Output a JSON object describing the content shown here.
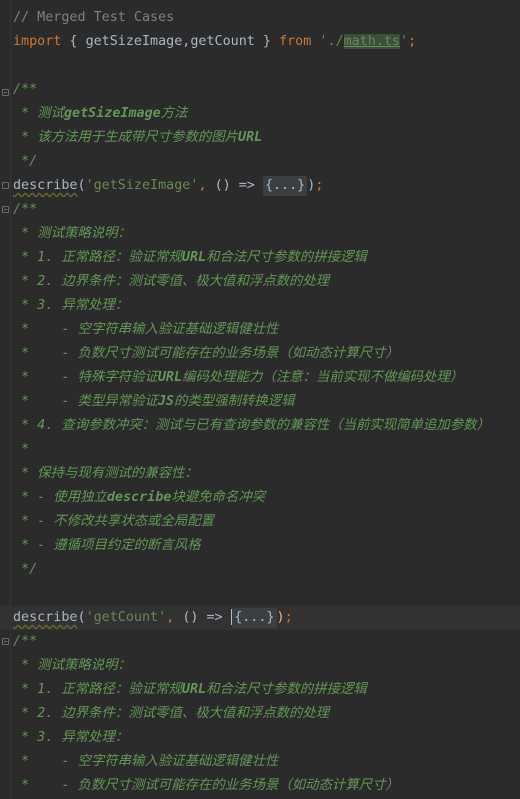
{
  "editor": {
    "lines": [
      {
        "t": "comment",
        "text": "// Merged Test Cases"
      },
      {
        "t": "import",
        "kw1": "import",
        "open": " { ",
        "names": "getSizeImage,getCount",
        "close": " } ",
        "kw2": "from",
        "sp": " ",
        "q1": "'./",
        "path": "math.ts",
        "q2": "'",
        "semi": ";"
      },
      {
        "t": "blank"
      },
      {
        "t": "doc",
        "text": "/**"
      },
      {
        "t": "doc",
        "text": " * 测试",
        "bold": "getSizeImage",
        "after": "方法"
      },
      {
        "t": "doc",
        "text": " * 该方法用于生成带尺寸参数的图片",
        "bold": "URL",
        "after": ""
      },
      {
        "t": "doc",
        "text": " */"
      },
      {
        "t": "describe",
        "fn": "describe",
        "arg": "'getSizeImage'",
        "mid": ", () => ",
        "folded": "{...}",
        "end": ");"
      },
      {
        "t": "doc",
        "text": "/**"
      },
      {
        "t": "doc",
        "text": " * 测试策略说明："
      },
      {
        "t": "doc",
        "text": " * 1. 正常路径：验证常规",
        "bold": "URL",
        "after": "和合法尺寸参数的拼接逻辑"
      },
      {
        "t": "doc",
        "text": " * 2. 边界条件：测试零值、极大值和浮点数的处理"
      },
      {
        "t": "doc",
        "text": " * 3. 异常处理："
      },
      {
        "t": "doc",
        "text": " *    - 空字符串输入验证基础逻辑健壮性"
      },
      {
        "t": "doc",
        "text": " *    - 负数尺寸测试可能存在的业务场景（如动态计算尺寸）"
      },
      {
        "t": "doc",
        "text": " *    - 特殊字符验证",
        "bold": "URL",
        "after": "编码处理能力（注意：当前实现不做编码处理）"
      },
      {
        "t": "doc",
        "text": " *    - 类型异常验证",
        "bold": "JS",
        "after": "的类型强制转换逻辑"
      },
      {
        "t": "doc",
        "text": " * 4. 查询参数冲突：测试与已有查询参数的兼容性（当前实现简单追加参数）"
      },
      {
        "t": "doc",
        "text": " *"
      },
      {
        "t": "doc",
        "text": " * 保持与现有测试的兼容性："
      },
      {
        "t": "doc",
        "text": " * - 使用独立",
        "bold": "describe",
        "after": "块避免命名冲突"
      },
      {
        "t": "doc",
        "text": " * - 不修改共享状态或全局配置"
      },
      {
        "t": "doc",
        "text": " * - 遵循项目约定的断言风格"
      },
      {
        "t": "doc",
        "text": " */"
      },
      {
        "t": "blank"
      },
      {
        "t": "describe2",
        "fn": "describe",
        "arg": "'getCount'",
        "mid": ", () => ",
        "folded": "{...}",
        "end": ");"
      },
      {
        "t": "doc",
        "text": "/**"
      },
      {
        "t": "doc",
        "text": " * 测试策略说明："
      },
      {
        "t": "doc",
        "text": " * 1. 正常路径：验证常规",
        "bold": "URL",
        "after": "和合法尺寸参数的拼接逻辑"
      },
      {
        "t": "doc",
        "text": " * 2. 边界条件：测试零值、极大值和浮点数的处理"
      },
      {
        "t": "doc",
        "text": " * 3. 异常处理："
      },
      {
        "t": "doc",
        "text": " *    - 空字符串输入验证基础逻辑健壮性"
      },
      {
        "t": "doc",
        "text": " *    - 负数尺寸测试可能存在的业务场景（如动态计算尺寸）"
      }
    ]
  }
}
